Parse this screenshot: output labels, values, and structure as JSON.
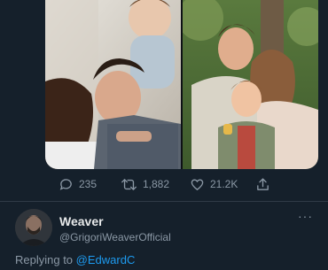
{
  "tweet": {
    "actions": {
      "reply_count": "235",
      "retweet_count": "1,882",
      "like_count": "21.2K"
    }
  },
  "reply": {
    "author_name": "Weaver",
    "author_handle": "@GrigoriWeaverOfficial",
    "replying_prefix": "Replying to",
    "replying_mention": "@EdwardC",
    "more_label": "···"
  },
  "icons": {
    "reply": "comment-icon",
    "retweet": "retweet-icon",
    "like": "heart-icon",
    "share": "share-icon",
    "more": "more-icon"
  },
  "colors": {
    "background": "#15202b",
    "muted_text": "#8b98a5",
    "link": "#1d9bf0"
  }
}
